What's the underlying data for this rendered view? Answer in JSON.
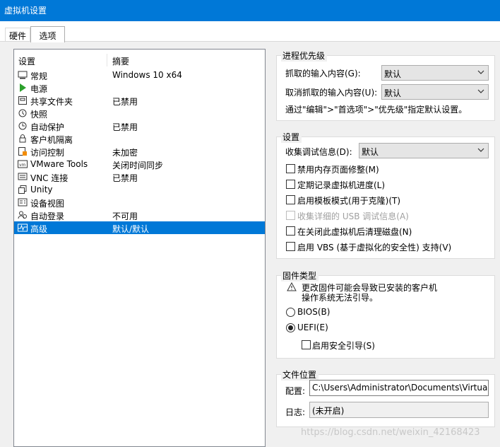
{
  "window": {
    "title": "虚拟机设置"
  },
  "tabs": [
    {
      "label": "硬件",
      "active": false
    },
    {
      "label": "选项",
      "active": true
    }
  ],
  "list": {
    "headers": {
      "setting": "设置",
      "summary": "摘要"
    },
    "items": [
      {
        "name": "常规",
        "summary": "Windows 10 x64",
        "icon": "general-icon"
      },
      {
        "name": "电源",
        "summary": "",
        "icon": "power-play-icon"
      },
      {
        "name": "共享文件夹",
        "summary": "已禁用",
        "icon": "shared-folders-icon"
      },
      {
        "name": "快照",
        "summary": "",
        "icon": "snapshot-icon"
      },
      {
        "name": "自动保护",
        "summary": "已禁用",
        "icon": "autoprotect-clock-icon"
      },
      {
        "name": "客户机隔离",
        "summary": "",
        "icon": "lock-icon"
      },
      {
        "name": "访问控制",
        "summary": "未加密",
        "icon": "access-control-icon"
      },
      {
        "name": "VMware Tools",
        "summary": "关闭时间同步",
        "icon": "vmware-tools-icon"
      },
      {
        "name": "VNC 连接",
        "summary": "已禁用",
        "icon": "vnc-icon"
      },
      {
        "name": "Unity",
        "summary": "",
        "icon": "unity-icon"
      },
      {
        "name": "设备视图",
        "summary": "",
        "icon": "device-view-icon"
      },
      {
        "name": "自动登录",
        "summary": "不可用",
        "icon": "autologin-users-icon"
      },
      {
        "name": "高级",
        "summary": "默认/默认",
        "icon": "advanced-pulse-icon",
        "selected": true
      }
    ]
  },
  "process_priority": {
    "title": "进程优先级",
    "grabbed_label": "抓取的输入内容(G):",
    "grabbed_value": "默认",
    "ungrabbed_label": "取消抓取的输入内容(U):",
    "ungrabbed_value": "默认",
    "hint": "通过\"编辑\">\"首选项\">\"优先级\"指定默认设置。"
  },
  "settings": {
    "title": "设置",
    "debug_label": "收集调试信息(D):",
    "debug_value": "默认",
    "checkboxes": [
      {
        "label": "禁用内存页面修整(M)",
        "checked": false,
        "disabled": false
      },
      {
        "label": "定期记录虚拟机进度(L)",
        "checked": false,
        "disabled": false
      },
      {
        "label": "启用模板模式(用于克隆)(T)",
        "checked": false,
        "disabled": false
      },
      {
        "label": "收集详细的 USB 调试信息(A)",
        "checked": false,
        "disabled": true
      },
      {
        "label": "在关闭此虚拟机后清理磁盘(N)",
        "checked": false,
        "disabled": false
      },
      {
        "label": "启用 VBS (基于虚拟化的安全性) 支持(V)",
        "checked": false,
        "disabled": false
      }
    ]
  },
  "firmware": {
    "title": "固件类型",
    "warning_line1": "更改固件可能会导致已安装的客户机",
    "warning_line2": "操作系统无法引导。",
    "bios_label": "BIOS(B)",
    "uefi_label": "UEFI(E)",
    "selected": "UEFI",
    "secure_boot_label": "启用安全引导(S)",
    "secure_boot_checked": false
  },
  "file_location": {
    "title": "文件位置",
    "config_label": "配置:",
    "config_value": "C:\\Users\\Administrator\\Documents\\Virtual Ma",
    "log_label": "日志:",
    "log_value": "(未开启)"
  },
  "watermark": "https://blog.csdn.net/weixin_42168423",
  "colors": {
    "accent": "#0078d7",
    "panel": "#f0f0f0"
  }
}
